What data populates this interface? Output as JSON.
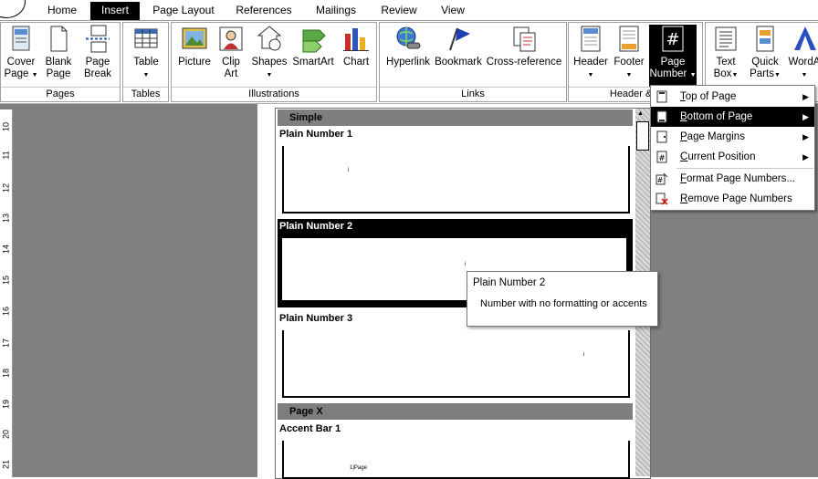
{
  "tabs": [
    "Home",
    "Insert",
    "Page Layout",
    "References",
    "Mailings",
    "Review",
    "View"
  ],
  "active_tab": "Insert",
  "ribbon": {
    "pages": {
      "label": "Pages",
      "cover_page": [
        "Cover",
        "Page"
      ],
      "blank_page": [
        "Blank",
        "Page"
      ],
      "page_break": [
        "Page",
        "Break"
      ]
    },
    "tables": {
      "label": "Tables",
      "table": "Table"
    },
    "illustrations": {
      "label": "Illustrations",
      "picture": "Picture",
      "clip_art": [
        "Clip",
        "Art"
      ],
      "shapes": "Shapes",
      "smartart": "SmartArt",
      "chart": "Chart"
    },
    "links": {
      "label": "Links",
      "hyperlink": "Hyperlink",
      "bookmark": "Bookmark",
      "cross_reference": "Cross-reference"
    },
    "header_footer": {
      "label": "Header & F",
      "header": "Header",
      "footer": "Footer",
      "page_number": [
        "Page",
        "Number"
      ]
    },
    "text": {
      "text_box": [
        "Text",
        "Box"
      ],
      "quick_parts": [
        "Quick",
        "Parts"
      ],
      "wordart": "WordA"
    }
  },
  "ruler": [
    "10",
    "11",
    "12",
    "13",
    "14",
    "15",
    "16",
    "17",
    "18",
    "19",
    "20",
    "21"
  ],
  "gallery": {
    "sections": [
      "Simple",
      "Page X"
    ],
    "items": [
      "Plain Number 1",
      "Plain Number 2",
      "Plain Number 3",
      "Accent Bar 1"
    ],
    "thumb_marks": [
      "i",
      "i",
      "i",
      "1|Page"
    ],
    "selected": "Plain Number 2"
  },
  "menu": {
    "items": [
      {
        "label": "Top of Page",
        "accel": "T",
        "rest": "op of Page",
        "submenu": true
      },
      {
        "label": "Bottom of Page",
        "accel": "B",
        "rest": "ottom of Page",
        "submenu": true
      },
      {
        "label": "Page Margins",
        "accel": "P",
        "rest": "age Margins",
        "submenu": true
      },
      {
        "label": "Current Position",
        "accel": "C",
        "rest": "urrent Position",
        "submenu": true
      },
      {
        "label": "Format Page Numbers...",
        "accel": "F",
        "rest": "ormat Page Numbers...",
        "submenu": false
      },
      {
        "label": "Remove Page Numbers",
        "accel": "R",
        "rest": "emove Page Numbers",
        "submenu": false
      }
    ],
    "highlighted": "Bottom of Page"
  },
  "tooltip": {
    "title": "Plain Number 2",
    "desc": "Number with no formatting or accents"
  },
  "colors": {
    "highlight": "#000000",
    "ribbon_bg": "#ffffff",
    "document_bg": "#808080",
    "section_header": "#7e7e7e"
  }
}
